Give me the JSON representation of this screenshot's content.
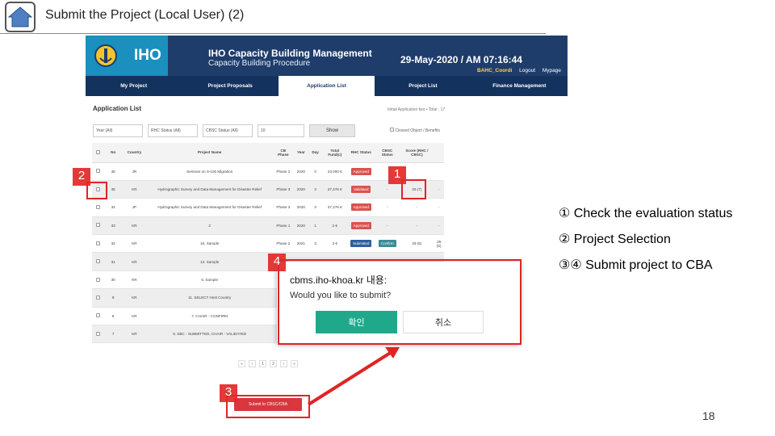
{
  "slide": {
    "title": "Submit the Project (Local User) (2)",
    "page_number": "18"
  },
  "iho": {
    "abbr": "IHO",
    "title": "IHO Capacity Building Management",
    "subtitle": "Capacity Building Procedure",
    "date": "29-May-2020 / AM 07:16:44",
    "user": "BAHC_Coordi",
    "logout": "Logout",
    "mypage": "Mypage",
    "nav": [
      "My Project",
      "Project Proposals",
      "Application List",
      "Project List",
      "Finance Management"
    ],
    "active_nav": "Application List",
    "colors": {
      "header": "#1f3d6b",
      "logo_bg": "#1b8fbd"
    }
  },
  "app_list": {
    "heading": "Application List",
    "hint": "Initial Application ties • Total : 17",
    "filters": [
      "Year (All)",
      "RHC Status (All)",
      "CBSC Status (All)",
      "10"
    ],
    "show_label": "Show",
    "check_label": "Cleared Object / Benefits",
    "columns": [
      "",
      "No",
      "Country",
      "Project Name",
      "CB Phase",
      "Year",
      "Day",
      "Total Fund(c)",
      "RHC Status",
      "CBSC Status",
      "Score (RHC / CBSC)",
      ""
    ],
    "rows": [
      {
        "no": "36",
        "country": "JR",
        "name": "Seminar on S-100 Migration",
        "phase": "Phase 2",
        "year": "2020",
        "day": "0",
        "fund": "23,000 €",
        "rhc": "Approved",
        "cbsc": "",
        "score": "",
        "extra": ""
      },
      {
        "no": "35",
        "country": "KR",
        "name": "Hydrographic Survey and Data Management for Disaster Relief",
        "phase": "Phase 3",
        "year": "2020",
        "day": "3",
        "fund": "37,276 €",
        "rhc": "Validated",
        "cbsc": "-",
        "score": "29 (7)",
        "extra": "-"
      },
      {
        "no": "34",
        "country": "JP",
        "name": "Hydrographic Survey and Data Management for Disaster Relief",
        "phase": "Phase 3",
        "year": "2020",
        "day": "3",
        "fund": "37,276 €",
        "rhc": "Approved",
        "cbsc": "-",
        "score": "-",
        "extra": "-"
      },
      {
        "no": "33",
        "country": "KR",
        "name": "2",
        "phase": "Phase 1",
        "year": "2020",
        "day": "1",
        "fund": "2 €",
        "rhc": "Approved",
        "cbsc": "-",
        "score": "-",
        "extra": "-"
      },
      {
        "no": "32",
        "country": "KR",
        "name": "16. Sample",
        "phase": "Phase 2",
        "year": "2021",
        "day": "3",
        "fund": "3 €",
        "rhc": "Submitted",
        "cbsc": "Confirm",
        "score": "29 (5)",
        "extra": "29 (5)"
      },
      {
        "no": "31",
        "country": "KR",
        "name": "13. Sample",
        "phase": "Phase",
        "year": "",
        "day": "",
        "fund": "",
        "rhc": "",
        "cbsc": "",
        "score": "",
        "extra": ""
      },
      {
        "no": "30",
        "country": "KR",
        "name": "5. Sample",
        "phase": "Phase",
        "year": "",
        "day": "",
        "fund": "",
        "rhc": "",
        "cbsc": "",
        "score": "",
        "extra": ""
      },
      {
        "no": "9",
        "country": "KR",
        "name": "11. SELECT Host Country",
        "phase": "Phase",
        "year": "",
        "day": "",
        "fund": "",
        "rhc": "",
        "cbsc": "",
        "score": "",
        "extra": ""
      },
      {
        "no": "8",
        "country": "KR",
        "name": "7. CHAIR - CONFIRM",
        "phase": "Phase",
        "year": "",
        "day": "",
        "fund": "",
        "rhc": "",
        "cbsc": "",
        "score": "",
        "extra": ""
      },
      {
        "no": "7",
        "country": "KR",
        "name": "6. SBC - SUBMITTED, CHAIR - VALIDATED",
        "phase": "Phase",
        "year": "",
        "day": "",
        "fund": "",
        "rhc": "",
        "cbsc": "",
        "score": "",
        "extra": ""
      }
    ],
    "pager": [
      "«",
      "‹",
      "1",
      "2",
      "›",
      "»"
    ],
    "submit_label": "Submit to CBSC/CBA"
  },
  "dialog": {
    "domain": "cbms.iho-khoa.kr 내용:",
    "message": "Would you like to submit?",
    "ok_label": "확인",
    "cancel_label": "취소"
  },
  "annotations": {
    "badge_1": "1",
    "badge_2": "2",
    "badge_3": "3",
    "badge_4": "4",
    "color": "#e02424"
  },
  "legend": {
    "line1": "① Check the evaluation status",
    "line2": "② Project Selection",
    "line3": "③④ Submit project to CBA"
  }
}
